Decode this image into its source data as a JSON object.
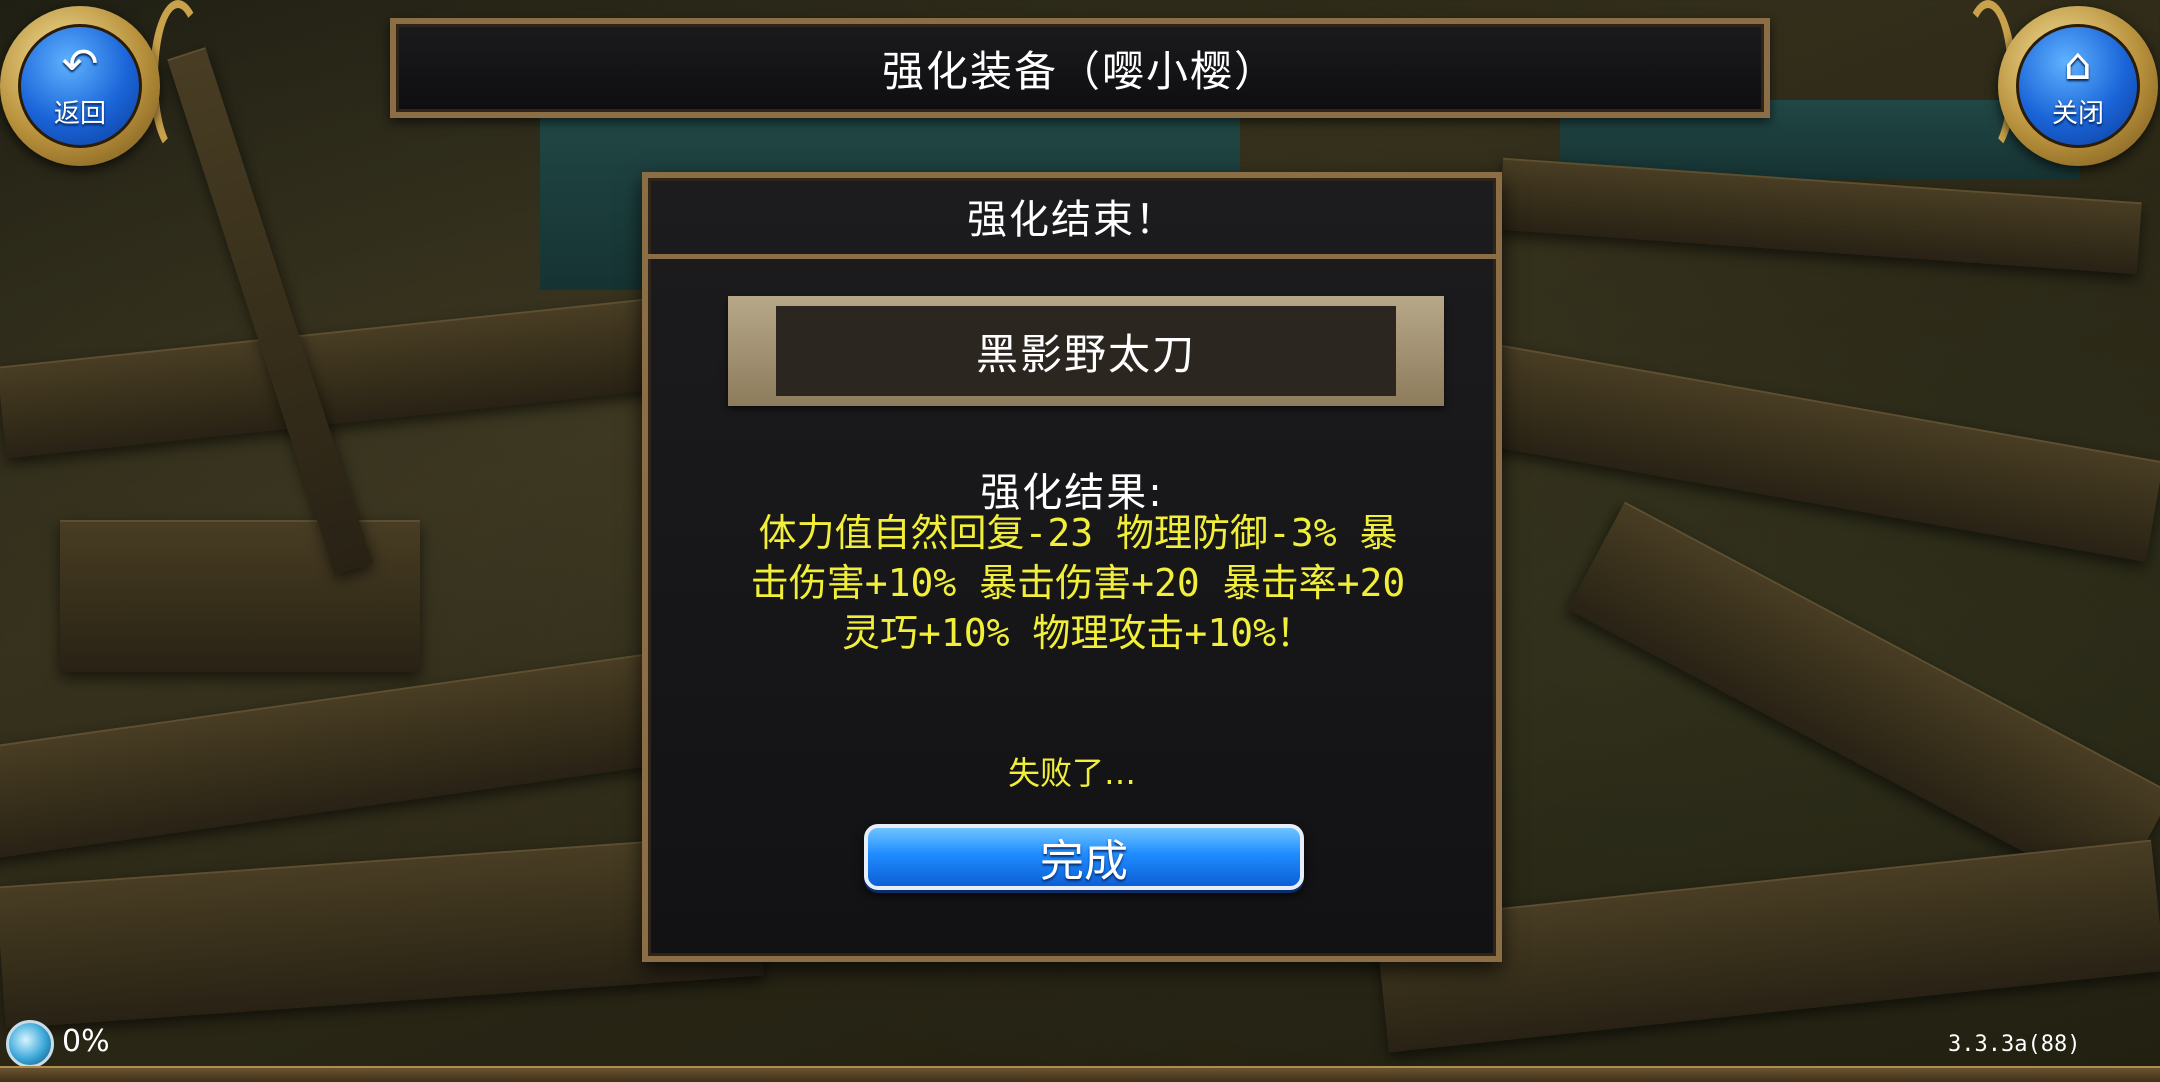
{
  "header": {
    "title": "强化装备（嘤小樱）",
    "back_label": "返回",
    "back_icon": "back-arrow-icon",
    "close_label": "关闭",
    "close_icon": "home-icon"
  },
  "dialog": {
    "title": "强化结束！",
    "item_name": "黑影野太刀",
    "result_label": "强化结果:",
    "result_lines": [
      "体力值自然回复-23 物理防御-3% 暴",
      "击伤害+10% 暴击伤害+20 暴击率+20",
      "灵巧+10% 物理攻击+10%！"
    ],
    "status_text": "失败了…",
    "done_label": "完成"
  },
  "footer": {
    "progress_text": "0%",
    "version": "3.3.3a(88)"
  },
  "colors": {
    "highlight_text": "#f2ef3a",
    "frame": "#8c6e46",
    "button_blue": "#1f8cff"
  }
}
